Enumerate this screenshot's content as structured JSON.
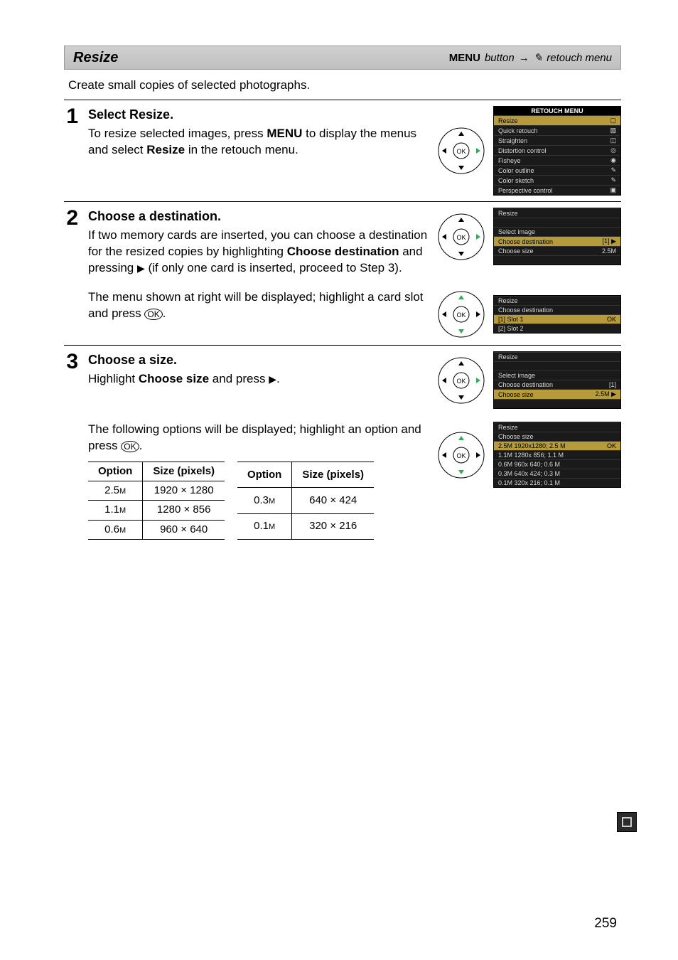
{
  "header": {
    "title": "Resize",
    "menu_word": "MENU",
    "button_word": "button",
    "arrow": "→",
    "retouch_icon": "✎",
    "retouch_label": "retouch menu"
  },
  "intro": "Create small copies of selected photographs.",
  "steps": {
    "s1": {
      "num": "1",
      "heading": "Select Resize.",
      "p1_a": "To resize selected images, press ",
      "p1_menu": "MENU",
      "p1_b": " to display the menus and select ",
      "p1_bold": "Resize",
      "p1_c": " in the retouch menu."
    },
    "s2": {
      "num": "2",
      "heading": "Choose a destination.",
      "p1_a": "If two memory cards are inserted, you can choose a destination for the resized copies by highlighting ",
      "p1_bold": "Choose destination",
      "p1_b": " and pressing ",
      "p1_tri": "▶",
      "p1_c": " (if only one card is inserted, proceed to Step 3).",
      "p2_a": "The menu shown at right will be displayed; highlight a card slot and press ",
      "p2_ok": "OK",
      "p2_b": "."
    },
    "s3": {
      "num": "3",
      "heading": "Choose a size.",
      "p1_a": "Highlight ",
      "p1_bold": "Choose size",
      "p1_b": " and press ",
      "p1_tri": "▶",
      "p1_c": ".",
      "p2_a": "The following options will be displayed; highlight an option and press ",
      "p2_ok": "OK",
      "p2_b": "."
    }
  },
  "lcd1": {
    "title": "RETOUCH MENU",
    "rows": [
      {
        "l": "Resize",
        "r": "▢",
        "hl": true
      },
      {
        "l": "Quick retouch",
        "r": "▧"
      },
      {
        "l": "Straighten",
        "r": "◫"
      },
      {
        "l": "Distortion control",
        "r": "◎"
      },
      {
        "l": "Fisheye",
        "r": "◉"
      },
      {
        "l": "Color outline",
        "r": "✎"
      },
      {
        "l": "Color sketch",
        "r": "✎"
      },
      {
        "l": "Perspective control",
        "r": "▣"
      }
    ]
  },
  "lcd2": {
    "title": "Resize",
    "rows": [
      {
        "l": "",
        "r": ""
      },
      {
        "l": "Select image",
        "r": ""
      },
      {
        "l": "Choose destination",
        "r": "[1] ▶",
        "hl": true
      },
      {
        "l": "Choose size",
        "r": "2.5M"
      },
      {
        "l": "",
        "r": ""
      }
    ]
  },
  "lcd3": {
    "title": "Resize",
    "sub": "Choose destination",
    "rows": [
      {
        "l": "[1]  Slot 1",
        "r": "OK",
        "hl": true
      },
      {
        "l": "[2]  Slot 2",
        "r": ""
      }
    ]
  },
  "lcd4": {
    "title": "Resize",
    "rows": [
      {
        "l": "",
        "r": ""
      },
      {
        "l": "Select image",
        "r": ""
      },
      {
        "l": "Choose destination",
        "r": "[1]"
      },
      {
        "l": "Choose size",
        "r": "2.5M ▶",
        "hl": true
      },
      {
        "l": "",
        "r": ""
      }
    ]
  },
  "lcd5": {
    "title": "Resize",
    "sub": "Choose size",
    "rows": [
      {
        "l": "2.5M 1920x1280; 2.5 M",
        "r": "OK",
        "hl": true
      },
      {
        "l": "1.1M 1280x 856; 1.1 M",
        "r": ""
      },
      {
        "l": "0.6M  960x 640; 0.6 M",
        "r": ""
      },
      {
        "l": "0.3M  640x 424; 0.3 M",
        "r": ""
      },
      {
        "l": "0.1M  320x 216; 0.1 M",
        "r": ""
      }
    ]
  },
  "size_table": {
    "h_option": "Option",
    "h_size": "Size (pixels)",
    "left": [
      {
        "opt": "2.5",
        "m": "M",
        "size": "1920 × 1280"
      },
      {
        "opt": "1.1",
        "m": "M",
        "size": "1280 × 856"
      },
      {
        "opt": "0.6",
        "m": "M",
        "size": "960 × 640"
      }
    ],
    "right": [
      {
        "opt": "0.3",
        "m": "M",
        "size": "640 × 424"
      },
      {
        "opt": "0.1",
        "m": "M",
        "size": "320 × 216"
      }
    ]
  },
  "page_number": "259"
}
